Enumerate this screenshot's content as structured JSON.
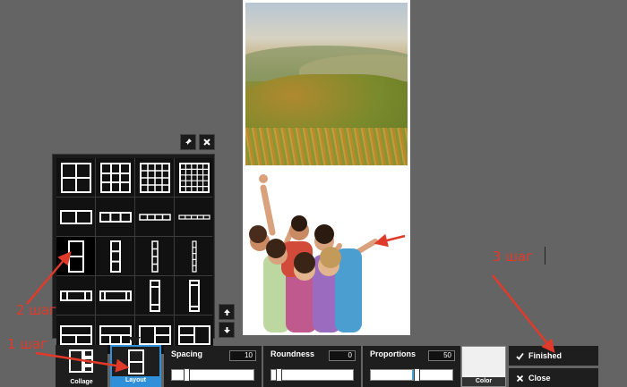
{
  "toolbar": {
    "collage_label": "Collage",
    "layout_label": "Layout",
    "color_label": "Color",
    "finished_label": "Finished",
    "close_label": "Close"
  },
  "sliders": {
    "spacing": {
      "label": "Spacing",
      "value": "10",
      "fraction": 0.1
    },
    "roundness": {
      "label": "Roundness",
      "value": "0",
      "fraction": 0.0
    },
    "proportions": {
      "label": "Proportions",
      "value": "50",
      "fraction": 0.5
    }
  },
  "annotations": {
    "step1": "1 шаг",
    "step2": "2 шаг",
    "step3": "3 шаг"
  },
  "icons": {
    "pin": "pin-icon",
    "close": "close-icon",
    "up": "arrow-up-icon",
    "down": "arrow-down-icon",
    "check": "checkmark-icon",
    "x": "x-icon"
  },
  "colors": {
    "accent": "#2f8fd8",
    "annotation": "#e03a2a",
    "panel": "#1b1b1b",
    "background": "#646464"
  }
}
